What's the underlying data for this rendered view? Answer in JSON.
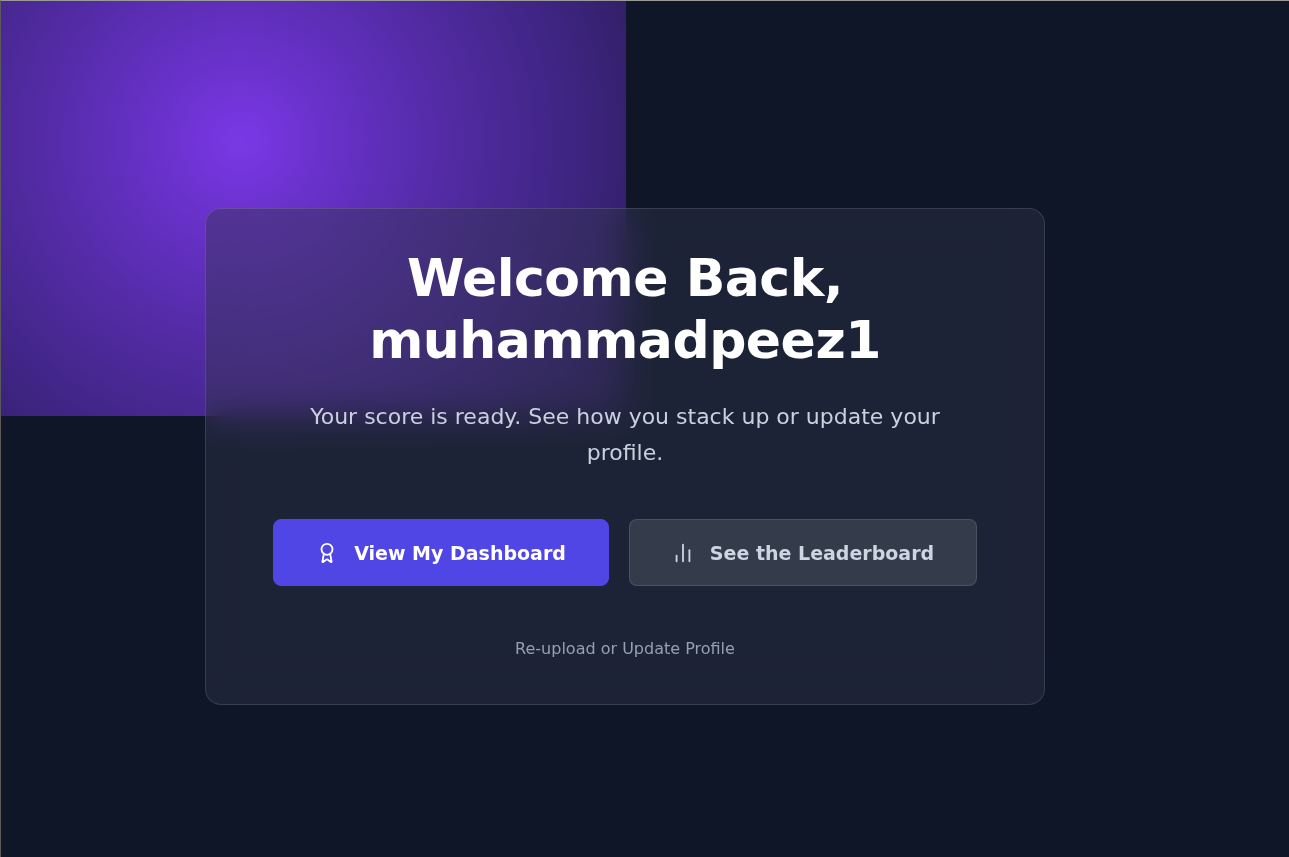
{
  "card": {
    "heading": {
      "greeting": "Welcome Back,",
      "username": "muhammadpeez1"
    },
    "subtitle": "Your score is ready. See how you stack up or update your profile.",
    "actions": [
      {
        "kind": "primary",
        "label": "View My Dashboard"
      },
      {
        "kind": "secondary",
        "label": "See the Leaderboard"
      }
    ],
    "link": "Re-upload or Update Profile"
  }
}
